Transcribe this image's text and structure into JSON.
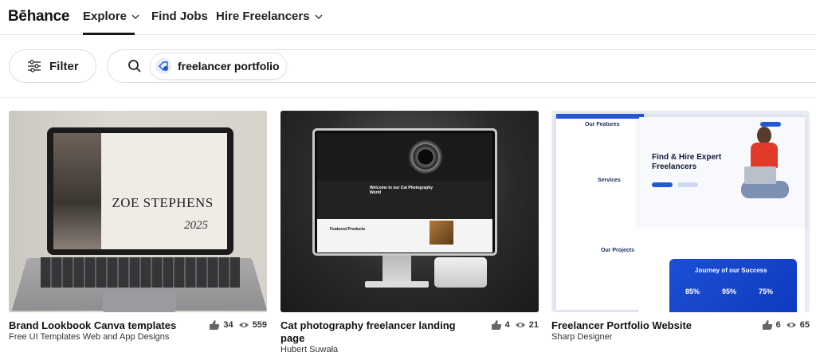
{
  "nav": {
    "logo": "Bēhance",
    "items": [
      {
        "label": "Explore",
        "has_dropdown": true,
        "active": true
      },
      {
        "label": "Find Jobs",
        "has_dropdown": false
      },
      {
        "label": "Hire Freelancers",
        "has_dropdown": true
      }
    ]
  },
  "filter": {
    "label": "Filter",
    "icon": "sliders-icon"
  },
  "search": {
    "icon": "search-icon",
    "chip_icon": "tag-search-icon",
    "query": "freelancer portfolio"
  },
  "cards": [
    {
      "title": "Brand Lookbook Canva templates",
      "owner": "Free UI Templates Web and App Designs",
      "likes": "34",
      "views": "559",
      "thumb": {
        "name_text": "ZOE STEPHENS",
        "year_text": "2025"
      }
    },
    {
      "title_line1": "Cat photography freelancer landing",
      "title_line2": "page",
      "owner": "Hubert Suwała",
      "likes": "4",
      "views": "21",
      "thumb": {
        "welcome_text": "Welcome to our Cat Photography World",
        "featured_text": "Featured Products"
      }
    },
    {
      "title": "Freelancer Portfolio Website",
      "owner": "Sharp Designer",
      "likes": "6",
      "views": "65",
      "thumb": {
        "headline": "Find & Hire Expert Freelancers",
        "features": "Our Features",
        "services": "Services",
        "projects": "Our Projects",
        "journey": "Journey of our Success",
        "pcts": [
          "85%",
          "95%",
          "75%"
        ]
      }
    }
  ]
}
